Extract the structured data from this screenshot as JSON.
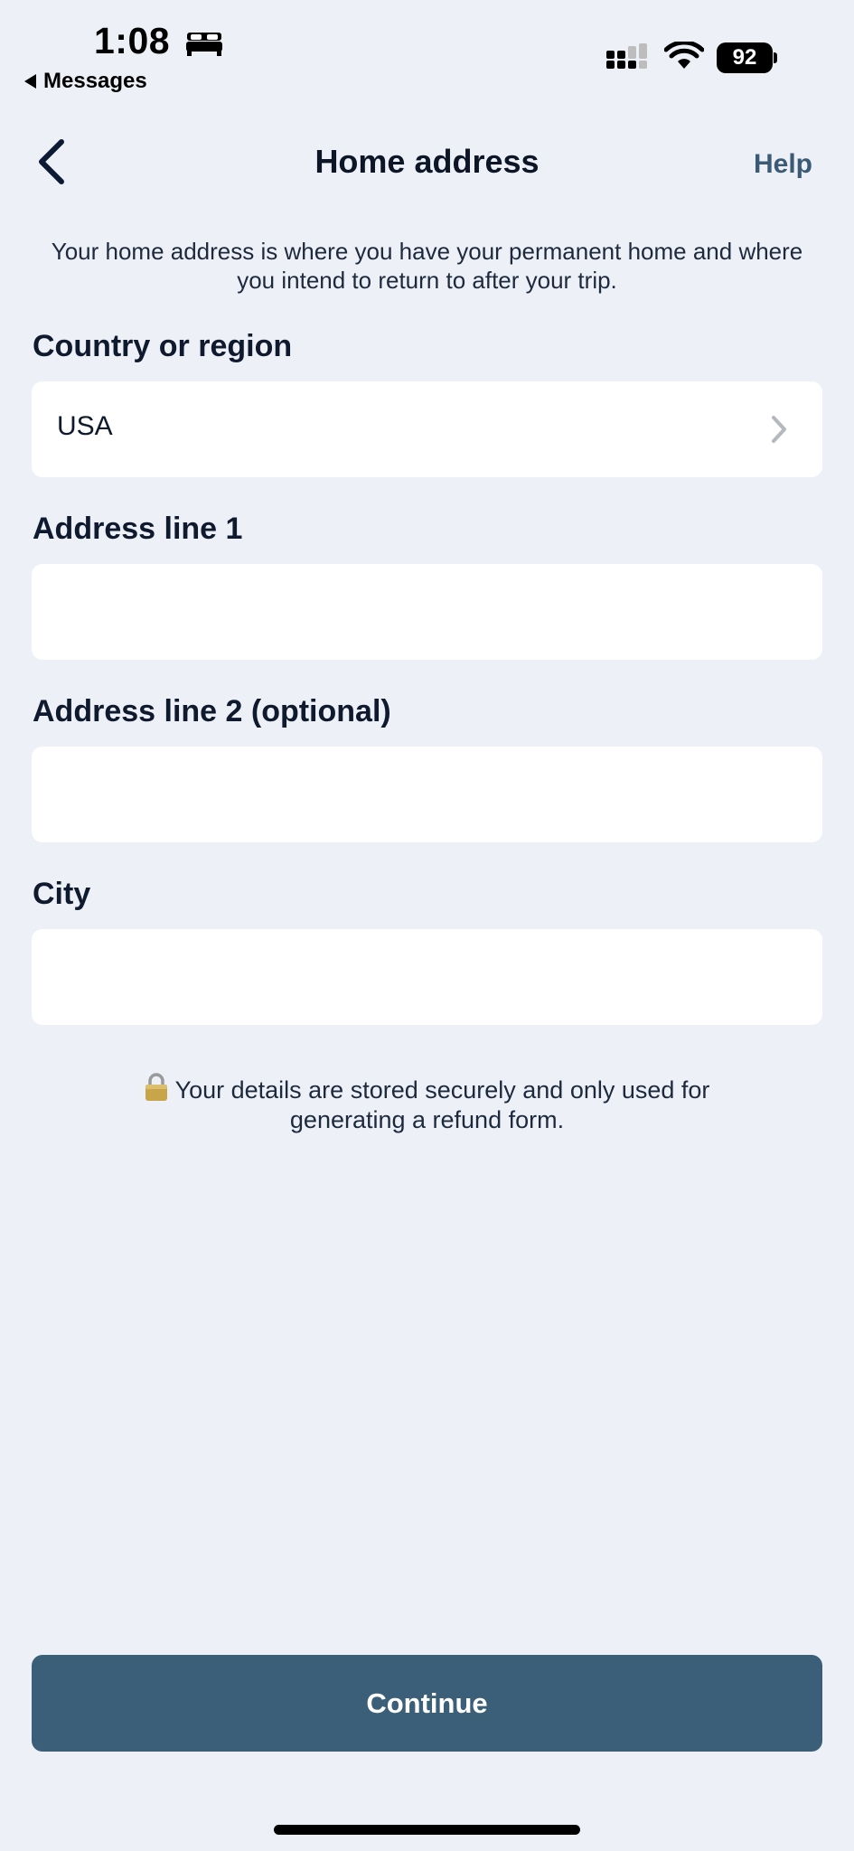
{
  "status_bar": {
    "time": "1:08",
    "back_app": "Messages",
    "battery": "92"
  },
  "nav": {
    "title": "Home address",
    "help": "Help"
  },
  "intro": "Your home address is where you have your permanent home and where you intend to return to after your trip.",
  "fields": {
    "country": {
      "label": "Country or region",
      "value": "USA"
    },
    "address1": {
      "label": "Address line 1",
      "value": "",
      "placeholder": ""
    },
    "address2": {
      "label": "Address line 2 (optional)",
      "value": "",
      "placeholder": ""
    },
    "city": {
      "label": "City",
      "value": "",
      "placeholder": ""
    }
  },
  "secure_note": "Your details are stored securely and only used for generating a refund form.",
  "continue_label": "Continue",
  "colors": {
    "background": "#edf1f7",
    "accent": "#3b5f78",
    "help_text": "#3b5a75"
  }
}
